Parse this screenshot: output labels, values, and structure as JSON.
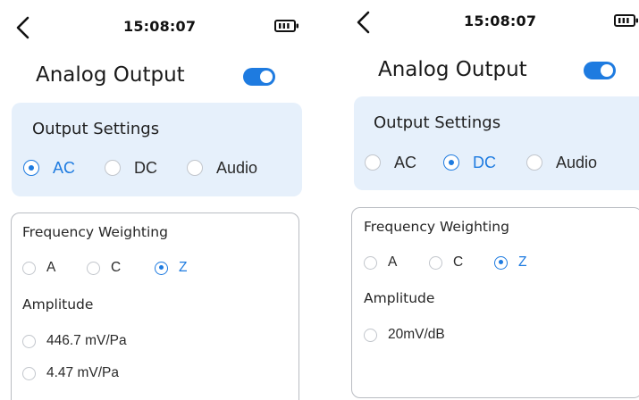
{
  "colors": {
    "accent": "#1e7be0",
    "settings_card_bg": "#e6f0fb",
    "card_border": "#b9bcc2",
    "radio_unselected": "#c2c6cc"
  },
  "screens": [
    {
      "status_bar": {
        "time": "15:08:07",
        "back_icon": "chevron-left-icon",
        "battery_icon": "battery-icon"
      },
      "title": "Analog Output",
      "output_enabled": true,
      "output_settings": {
        "heading": "Output Settings",
        "options": [
          "AC",
          "DC",
          "Audio"
        ],
        "selected": "AC"
      },
      "frequency_weighting": {
        "heading": "Frequency Weighting",
        "options": [
          "A",
          "C",
          "Z"
        ],
        "selected": "Z"
      },
      "amplitude": {
        "heading": "Amplitude",
        "options": [
          "446.7 mV/Pa",
          "4.47 mV/Pa"
        ],
        "selected": null
      }
    },
    {
      "status_bar": {
        "time": "15:08:07",
        "back_icon": "chevron-left-icon",
        "battery_icon": "battery-icon"
      },
      "title": "Analog Output",
      "output_enabled": true,
      "output_settings": {
        "heading": "Output Settings",
        "options": [
          "AC",
          "DC",
          "Audio"
        ],
        "selected": "DC"
      },
      "frequency_weighting": {
        "heading": "Frequency Weighting",
        "options": [
          "A",
          "C",
          "Z"
        ],
        "selected": "Z"
      },
      "amplitude": {
        "heading": "Amplitude",
        "options": [
          "20mV/dB"
        ],
        "selected": null
      }
    }
  ]
}
